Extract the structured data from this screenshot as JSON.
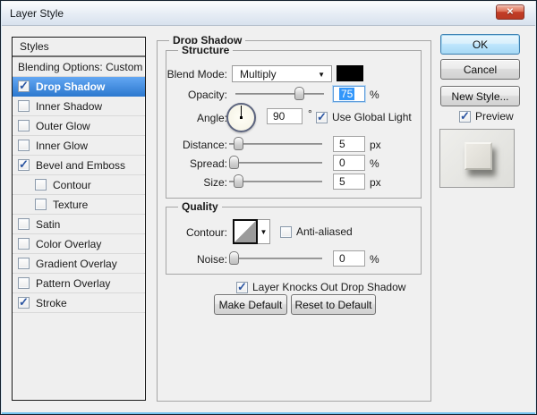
{
  "window": {
    "title": "Layer Style"
  },
  "icons": {
    "close": "✕",
    "chevron_down": "▼",
    "check": "✓"
  },
  "colors": {
    "selection_blue": "#2e7ad0",
    "shadow_swatch": "#000000",
    "field_selection": "#3296fa"
  },
  "sidebar": {
    "header": "Styles",
    "items": [
      {
        "label": "Blending Options: Custom",
        "has_checkbox": false,
        "checked": false,
        "selected": false
      },
      {
        "label": "Drop Shadow",
        "has_checkbox": true,
        "checked": true,
        "selected": true
      },
      {
        "label": "Inner Shadow",
        "has_checkbox": true,
        "checked": false,
        "selected": false
      },
      {
        "label": "Outer Glow",
        "has_checkbox": true,
        "checked": false,
        "selected": false
      },
      {
        "label": "Inner Glow",
        "has_checkbox": true,
        "checked": false,
        "selected": false
      },
      {
        "label": "Bevel and Emboss",
        "has_checkbox": true,
        "checked": true,
        "selected": false
      },
      {
        "label": "Contour",
        "has_checkbox": true,
        "checked": false,
        "selected": false,
        "indent": true
      },
      {
        "label": "Texture",
        "has_checkbox": true,
        "checked": false,
        "selected": false,
        "indent": true
      },
      {
        "label": "Satin",
        "has_checkbox": true,
        "checked": false,
        "selected": false
      },
      {
        "label": "Color Overlay",
        "has_checkbox": true,
        "checked": false,
        "selected": false
      },
      {
        "label": "Gradient Overlay",
        "has_checkbox": true,
        "checked": false,
        "selected": false
      },
      {
        "label": "Pattern Overlay",
        "has_checkbox": true,
        "checked": false,
        "selected": false
      },
      {
        "label": "Stroke",
        "has_checkbox": true,
        "checked": true,
        "selected": false
      }
    ]
  },
  "panel": {
    "title": "Drop Shadow",
    "structure": {
      "title": "Structure",
      "blend_mode": {
        "label": "Blend Mode:",
        "value": "Multiply",
        "swatch_color": "#000000"
      },
      "opacity": {
        "label": "Opacity:",
        "value": "75",
        "unit": "%",
        "slider_pos": 0.75,
        "value_selected": true
      },
      "angle": {
        "label": "Angle:",
        "value": "90",
        "unit": "°",
        "use_global_light": {
          "label": "Use Global Light",
          "checked": true
        }
      },
      "distance": {
        "label": "Distance:",
        "value": "5",
        "unit": "px",
        "slider_pos": 0.05
      },
      "spread": {
        "label": "Spread:",
        "value": "0",
        "unit": "%",
        "slider_pos": 0.0
      },
      "size": {
        "label": "Size:",
        "value": "5",
        "unit": "px",
        "slider_pos": 0.05
      }
    },
    "quality": {
      "title": "Quality",
      "contour": {
        "label": "Contour:",
        "anti_aliased": {
          "label": "Anti-aliased",
          "checked": false
        }
      },
      "noise": {
        "label": "Noise:",
        "value": "0",
        "unit": "%",
        "slider_pos": 0.0
      }
    },
    "knockout": {
      "label": "Layer Knocks Out Drop Shadow",
      "checked": true
    },
    "buttons": {
      "make_default": "Make Default",
      "reset_to_default": "Reset to Default"
    }
  },
  "actions": {
    "ok": "OK",
    "cancel": "Cancel",
    "new_style": "New Style...",
    "preview": {
      "label": "Preview",
      "checked": true
    }
  }
}
